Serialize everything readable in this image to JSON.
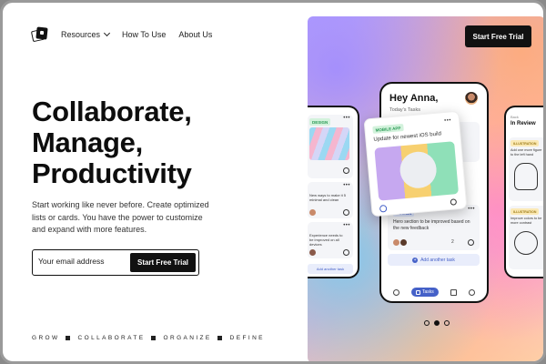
{
  "nav": {
    "items": [
      {
        "label": "Resources",
        "has_dropdown": true
      },
      {
        "label": "How To Use"
      },
      {
        "label": "About Us"
      }
    ]
  },
  "hero": {
    "headline": [
      "Collaborate,",
      "Manage,",
      "Productivity"
    ],
    "subtitle": "Start working like never before. Create optimized lists or cards. You have the power to customize and expand with more features.",
    "email_placeholder": "Your email address",
    "cta_label": "Start Free Trial",
    "tags": [
      "GROW",
      "COLLABORATE",
      "ORGANIZE",
      "DEFINE"
    ]
  },
  "header_cta": "Start Free Trial",
  "phone_center": {
    "greeting": "Hey Anna,",
    "subtitle": "Today's Tasks",
    "cards": [
      {
        "tag": "DESIGN",
        "text": "Hero section to be improved based on the new feedback",
        "count": "2"
      }
    ],
    "add_task_label": "Add another task",
    "active_tab": "Tasks"
  },
  "float_card": {
    "tag": "MOBILE APP",
    "text": "Update for newest iOS build"
  },
  "phone_left": {
    "tag": "DESIGN",
    "card_texts": [
      "New ways to make it 5 minimal and clean",
      "Experience needs to be improved on all devices"
    ],
    "add_task_label": "Add another task"
  },
  "phone_right": {
    "back_label": "Back",
    "title": "In Review",
    "cards": [
      {
        "tag": "ILLUSTRATION",
        "text": "Add one more figure to the left hand"
      },
      {
        "tag": "ILLUSTRATION",
        "text": "Improve colors to be more contrast"
      }
    ]
  },
  "pager": {
    "count": 3,
    "active_index": 1
  },
  "colors": {
    "accent_blue": "#4561c8",
    "dark": "#111111",
    "tag_green": "#2a9a55",
    "tag_yellow": "#9c7a17"
  }
}
